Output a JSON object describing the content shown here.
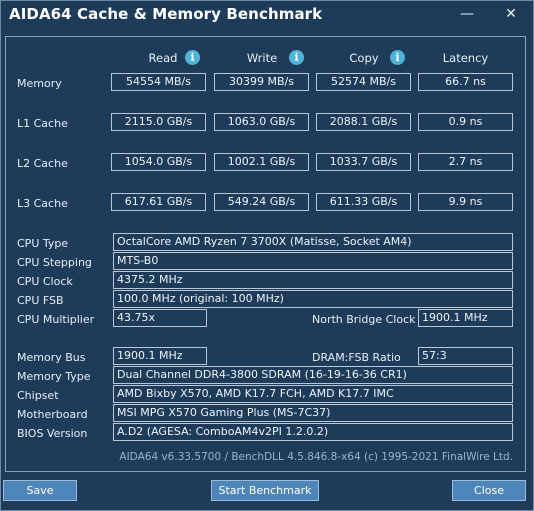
{
  "window": {
    "title": "AIDA64 Cache & Memory Benchmark",
    "minimize": "—",
    "close": "✕"
  },
  "columns": {
    "read": "Read",
    "write": "Write",
    "copy": "Copy",
    "latency": "Latency",
    "info_glyph": "i"
  },
  "bench_rows": [
    {
      "label": "Memory",
      "read": "54554 MB/s",
      "write": "30399 MB/s",
      "copy": "52574 MB/s",
      "latency": "66.7 ns"
    },
    {
      "label": "L1 Cache",
      "read": "2115.0 GB/s",
      "write": "1063.0 GB/s",
      "copy": "2088.1 GB/s",
      "latency": "0.9 ns"
    },
    {
      "label": "L2 Cache",
      "read": "1054.0 GB/s",
      "write": "1002.1 GB/s",
      "copy": "1033.7 GB/s",
      "latency": "2.7 ns"
    },
    {
      "label": "L3 Cache",
      "read": "617.61 GB/s",
      "write": "549.24 GB/s",
      "copy": "611.33 GB/s",
      "latency": "9.9 ns"
    }
  ],
  "cpu": {
    "type_label": "CPU Type",
    "type": "OctalCore AMD Ryzen 7 3700X  (Matisse, Socket AM4)",
    "stepping_label": "CPU Stepping",
    "stepping": "MTS-B0",
    "clock_label": "CPU Clock",
    "clock": "4375.2 MHz",
    "fsb_label": "CPU FSB",
    "fsb": "100.0 MHz  (original: 100 MHz)",
    "multiplier_label": "CPU Multiplier",
    "multiplier": "43.75x",
    "nb_clock_label": "North Bridge Clock",
    "nb_clock": "1900.1 MHz"
  },
  "memory": {
    "bus_label": "Memory Bus",
    "bus": "1900.1 MHz",
    "ratio_label": "DRAM:FSB Ratio",
    "ratio": "57:3",
    "type_label": "Memory Type",
    "type": "Dual Channel DDR4-3800 SDRAM  (16-19-16-36 CR1)",
    "chipset_label": "Chipset",
    "chipset": "AMD Bixby X570, AMD K17.7 FCH, AMD K17.7 IMC",
    "motherboard_label": "Motherboard",
    "motherboard": "MSI MPG X570 Gaming Plus (MS-7C37)",
    "bios_label": "BIOS Version",
    "bios": "A.D2  (AGESA: ComboAM4v2PI 1.2.0.2)"
  },
  "footer": "AIDA64 v6.33.5700 / BenchDLL 4.5.846.8-x64  (c) 1995-2021 FinalWire Ltd.",
  "buttons": {
    "save": "Save",
    "start": "Start Benchmark",
    "close": "Close"
  }
}
